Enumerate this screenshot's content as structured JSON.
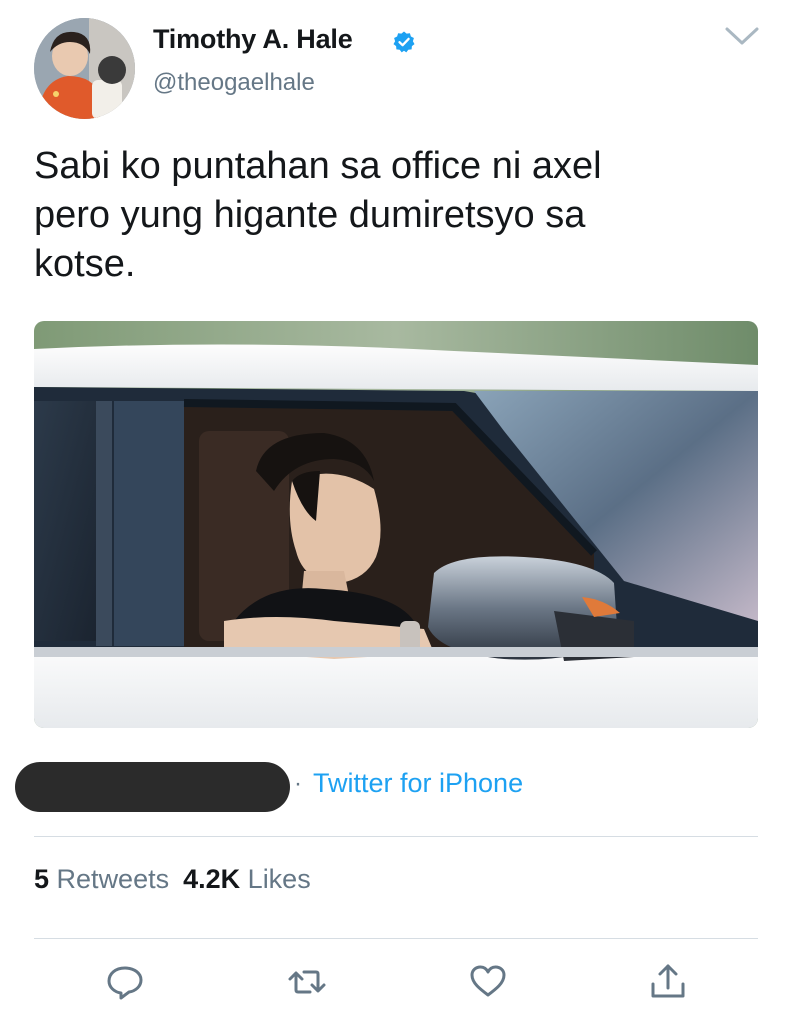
{
  "author": {
    "display_name": "Timothy A. Hale",
    "handle": "@theogaelhale",
    "verified": true
  },
  "tweet": {
    "text": "Sabi ko puntahan sa office ni axel\npero yung higante dumiretsyo sa\nkotse.",
    "source_separator": "·",
    "source": "Twitter for iPhone"
  },
  "stats": {
    "retweets_count": "5",
    "retweets_label": "Retweets",
    "likes_count": "4.2K",
    "likes_label": "Likes"
  },
  "icons": {
    "menu": "chevron-down-icon",
    "verified": "verified-badge-icon",
    "reply": "reply-icon",
    "retweet": "retweet-icon",
    "like": "heart-icon",
    "share": "share-icon"
  },
  "colors": {
    "accent": "#1da1f2",
    "secondary_text": "#657786",
    "primary_text": "#14171a",
    "divider": "#d6dde3"
  }
}
